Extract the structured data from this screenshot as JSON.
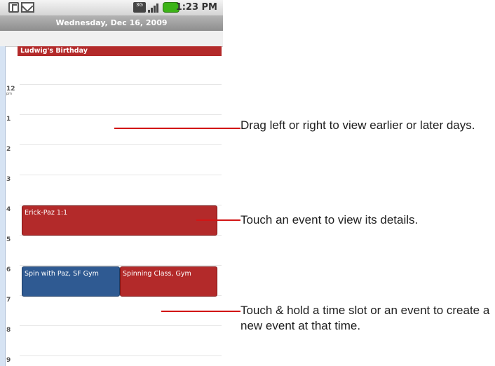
{
  "status_bar": {
    "time": "1:23 PM",
    "icons": [
      "calendar-notification-icon",
      "email-notification-icon",
      "3g-icon",
      "signal-icon",
      "battery-icon"
    ],
    "network_label": "3G"
  },
  "calendar": {
    "date_title": "Wednesday, Dec 16, 2009",
    "all_day_event": "Ludwig's Birthday",
    "hours": [
      {
        "label": "12",
        "ampm": "pm"
      },
      {
        "label": "1",
        "ampm": ""
      },
      {
        "label": "2",
        "ampm": ""
      },
      {
        "label": "3",
        "ampm": ""
      },
      {
        "label": "4",
        "ampm": ""
      },
      {
        "label": "5",
        "ampm": ""
      },
      {
        "label": "6",
        "ampm": ""
      },
      {
        "label": "7",
        "ampm": ""
      },
      {
        "label": "8",
        "ampm": ""
      },
      {
        "label": "9",
        "ampm": ""
      }
    ],
    "events": [
      {
        "title": "Erick-Paz 1:1",
        "color": "#b32a2a"
      },
      {
        "title": "Spin with Paz, SF Gym",
        "color": "#2f5a92"
      },
      {
        "title": "Spinning Class, Gym",
        "color": "#b32a2a"
      }
    ]
  },
  "callouts": {
    "swipe": "Drag left or right to view earlier or later days.",
    "touch_event": "Touch an event to view its details.",
    "touch_hold": "Touch & hold a time slot or an event to create a new event at that time."
  },
  "colors": {
    "callout_line": "#d21515",
    "event_red": "#b32a2a",
    "event_blue": "#2f5a92"
  }
}
